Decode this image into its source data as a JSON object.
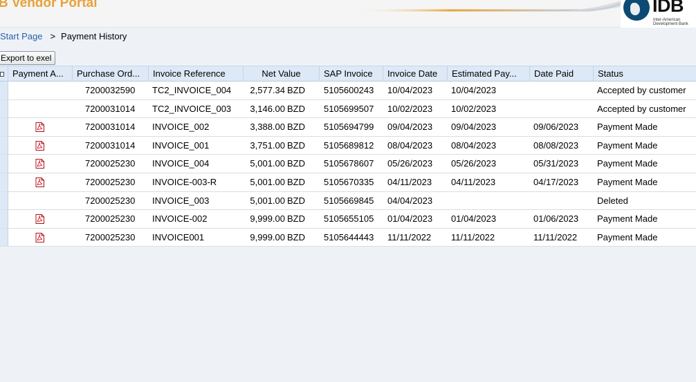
{
  "header": {
    "portal_title": "B Vendor Portal",
    "logo_text": "IDB",
    "logo_subtitle": "Inter-American Development Bank",
    "brand_color": "#e8a23a",
    "logo_color": "#0d4a73"
  },
  "breadcrumb": {
    "start_page": "Start Page",
    "separator": ">",
    "current": "Payment History"
  },
  "toolbar": {
    "export_label": "Export to exel"
  },
  "table": {
    "columns": [
      "Payment A...",
      "Purchase Ord...",
      "Invoice Reference",
      "Net Value",
      "SAP Invoice",
      "Invoice Date",
      "Estimated Pay...",
      "Date Paid",
      "Status"
    ],
    "rows": [
      {
        "pdf": false,
        "po": "7200032590",
        "ref": "TC2_INVOICE_004",
        "net": "2,577.34",
        "cur": "BZD",
        "sap": "5105600243",
        "inv_date": "10/04/2023",
        "est_pay": "10/04/2023",
        "paid": "",
        "status": "Accepted by customer"
      },
      {
        "pdf": false,
        "po": "7200031014",
        "ref": "TC2_INVOICE_003",
        "net": "3,146.00",
        "cur": "BZD",
        "sap": "5105699507",
        "inv_date": "10/02/2023",
        "est_pay": "10/02/2023",
        "paid": "",
        "status": "Accepted by customer"
      },
      {
        "pdf": true,
        "po": "7200031014",
        "ref": "INVOICE_002",
        "net": "3,388.00",
        "cur": "BZD",
        "sap": "5105694799",
        "inv_date": "09/04/2023",
        "est_pay": "09/04/2023",
        "paid": "09/06/2023",
        "status": "Payment Made"
      },
      {
        "pdf": true,
        "po": "7200031014",
        "ref": "INVOICE_001",
        "net": "3,751.00",
        "cur": "BZD",
        "sap": "5105689812",
        "inv_date": "08/04/2023",
        "est_pay": "08/04/2023",
        "paid": "08/08/2023",
        "status": "Payment Made"
      },
      {
        "pdf": true,
        "po": "7200025230",
        "ref": "INVOICE_004",
        "net": "5,001.00",
        "cur": "BZD",
        "sap": "5105678607",
        "inv_date": "05/26/2023",
        "est_pay": "05/26/2023",
        "paid": "05/31/2023",
        "status": "Payment Made"
      },
      {
        "pdf": true,
        "po": "7200025230",
        "ref": "INVOICE-003-R",
        "net": "5,001.00",
        "cur": "BZD",
        "sap": "5105670335",
        "inv_date": "04/11/2023",
        "est_pay": "04/11/2023",
        "paid": "04/17/2023",
        "status": "Payment Made"
      },
      {
        "pdf": false,
        "po": "7200025230",
        "ref": "INVOICE_003",
        "net": "5,001.00",
        "cur": "BZD",
        "sap": "5105669845",
        "inv_date": "04/04/2023",
        "est_pay": "",
        "paid": "",
        "status": "Deleted"
      },
      {
        "pdf": true,
        "po": "7200025230",
        "ref": "INVOICE-002",
        "net": "9,999.00",
        "cur": "BZD",
        "sap": "5105655105",
        "inv_date": "01/04/2023",
        "est_pay": "01/04/2023",
        "paid": "01/06/2023",
        "status": "Payment Made"
      },
      {
        "pdf": true,
        "po": "7200025230",
        "ref": "INVOICE001",
        "net": "9,999.00",
        "cur": "BZD",
        "sap": "5105644443",
        "inv_date": "11/11/2022",
        "est_pay": "11/11/2022",
        "paid": "11/11/2022",
        "status": "Payment Made"
      }
    ]
  }
}
